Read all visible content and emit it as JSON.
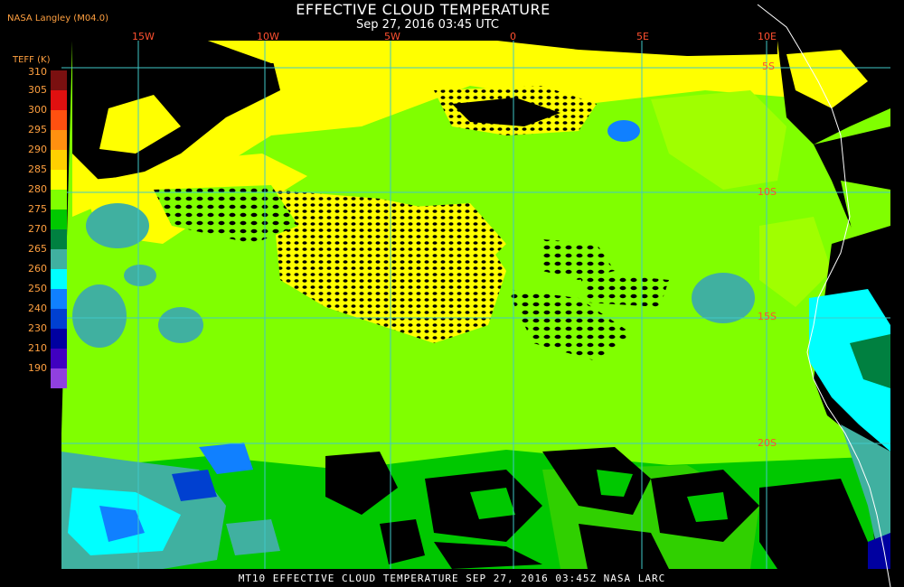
{
  "header": {
    "title": "EFFECTIVE CLOUD TEMPERATURE",
    "timestamp": "Sep 27, 2016 03:45 UTC",
    "product": "NASA Langley (M04.0)",
    "param_label": "TEFF (K)"
  },
  "legend": {
    "labels": [
      "310",
      "305",
      "300",
      "295",
      "290",
      "285",
      "280",
      "275",
      "270",
      "265",
      "260",
      "250",
      "240",
      "230",
      "210",
      "190"
    ],
    "colors": [
      "#7a1010",
      "#e01010",
      "#ff5010",
      "#ff9010",
      "#ffd000",
      "#ffff00",
      "#80ff00",
      "#00c800",
      "#008040",
      "#40b0a0",
      "#00ffff",
      "#1080ff",
      "#0040d0",
      "#0000a0",
      "#4000c0",
      "#9040e0"
    ]
  },
  "map": {
    "lon_labels": [
      "15W",
      "10W",
      "5W",
      "0",
      "5E",
      "10E"
    ],
    "lat_labels": [
      "5S",
      "10S",
      "15S",
      "20S"
    ],
    "background": "#000000",
    "grid_color": "#40c8c8",
    "coast_color": "#ffffff"
  },
  "footer": {
    "text": "MT10  EFFECTIVE CLOUD TEMPERATURE   SEP 27, 2016 03:45Z   NASA LARC"
  }
}
